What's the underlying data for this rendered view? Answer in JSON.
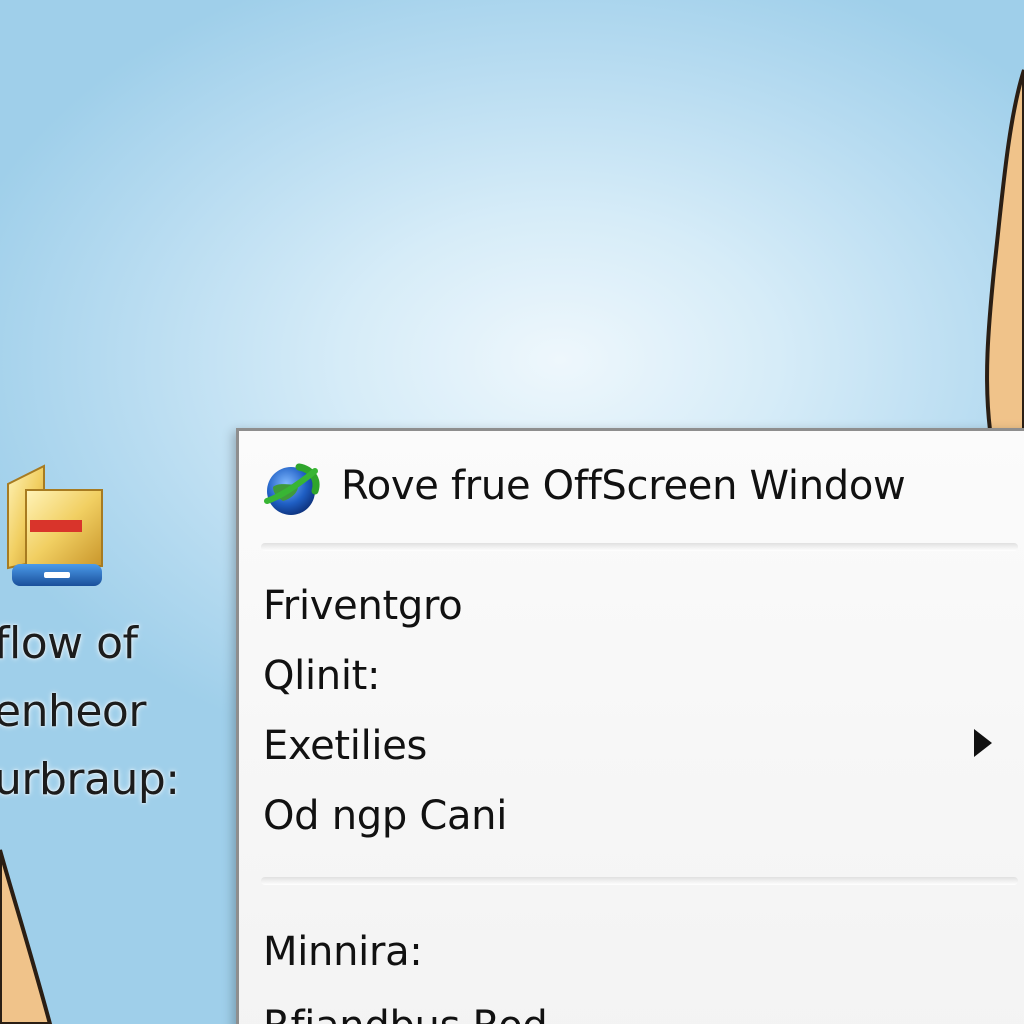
{
  "desktop": {
    "icon": {
      "icon_name": "folder-application-icon",
      "label": "flow of\nenheor\nurbraup:"
    }
  },
  "context_menu": {
    "items": [
      {
        "label": "Rove frue OffScreen Window",
        "icon": "globe-arrow-icon",
        "has_submenu": false
      },
      {
        "label": "Friventgro",
        "has_submenu": false
      },
      {
        "label": "Qlinit:",
        "has_submenu": false
      },
      {
        "label": "Exetilies",
        "has_submenu": true
      },
      {
        "label": "Od ngp Cani",
        "has_submenu": false
      },
      {
        "label": "Minnira:",
        "has_submenu": false
      },
      {
        "label": "Rfiandbus Rod",
        "has_submenu": false
      }
    ]
  },
  "colors": {
    "wallpaper_light": "#eef7fc",
    "wallpaper_dark": "#9fcfea",
    "menu_background": "#f7f7f7",
    "menu_border": "#8e8e8e",
    "text": "#111111",
    "skin_shape": "#f0c38a"
  }
}
